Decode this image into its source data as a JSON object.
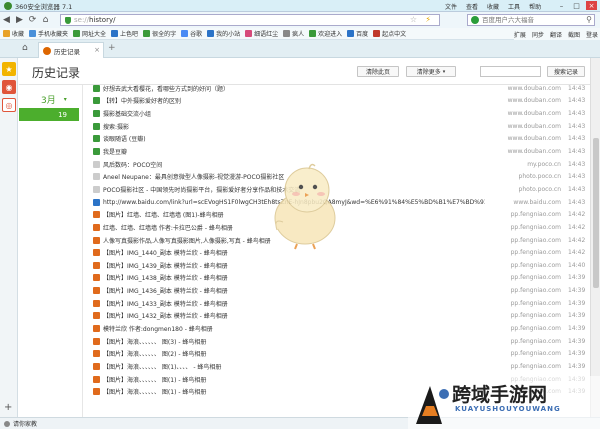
{
  "window": {
    "title": "360安全浏览器 7.1",
    "menus": [
      "文件",
      "查看",
      "收藏",
      "工具",
      "帮助"
    ]
  },
  "address": {
    "scheme": "se://",
    "path": "history/",
    "search_placeholder": "百度用户六大福音"
  },
  "bookmarks": {
    "items": [
      {
        "label": "收藏",
        "color": "#e8a22a"
      },
      {
        "label": "手机收藏夹",
        "color": "#4a90d9"
      },
      {
        "label": "网址大全",
        "color": "#3a9a3a"
      },
      {
        "label": "上色吧",
        "color": "#2b73c7"
      },
      {
        "label": "很全的字",
        "color": "#3a9a3a"
      },
      {
        "label": "谷歌",
        "color": "#4a8af4"
      },
      {
        "label": "我的小站",
        "color": "#2b73c7"
      },
      {
        "label": "细语红尘",
        "color": "#d64a7a"
      },
      {
        "label": "疯人",
        "color": "#888888"
      },
      {
        "label": "欢迎进入",
        "color": "#3a9a3a"
      },
      {
        "label": "百度",
        "color": "#2b73c7"
      },
      {
        "label": "起点中文",
        "color": "#c0392b"
      }
    ],
    "right": [
      "扩展",
      "同步",
      "翻译",
      "截图",
      "登录"
    ]
  },
  "tab": {
    "label": "历史记录"
  },
  "history": {
    "title": "历史记录",
    "clear_page": "清除此页",
    "clear_more": "清除更多",
    "search_button": "搜索记录",
    "month": "3月",
    "day": "19"
  },
  "rows": [
    {
      "title": "好想去武大看樱花，看哪些方式到的好问（题）",
      "host": "www.douban.com",
      "time": "14:43",
      "icon": "#3a9a3a"
    },
    {
      "title": "【转】中外摄影爱好者的区别",
      "host": "www.douban.com",
      "time": "14:43",
      "icon": "#3a9a3a"
    },
    {
      "title": "摄影基础交流小组",
      "host": "www.douban.com",
      "time": "14:43",
      "icon": "#3a9a3a"
    },
    {
      "title": "搜索:摄影",
      "host": "www.douban.com",
      "time": "14:43",
      "icon": "#3a9a3a"
    },
    {
      "title": "谈眼随语 (豆瓣)",
      "host": "www.douban.com",
      "time": "14:43",
      "icon": "#3a9a3a"
    },
    {
      "title": "我是豆瓣",
      "host": "www.douban.com",
      "time": "14:43",
      "icon": "#3a9a3a"
    },
    {
      "title": "风后数码：POCO空间",
      "host": "my.poco.cn",
      "time": "14:43",
      "icon": "#cccccc"
    },
    {
      "title": "Aneel Neupane：最具创意微型人像摄影-视觉漫游-POCO摄影社区",
      "host": "photo.poco.cn",
      "time": "14:43",
      "icon": "#cccccc"
    },
    {
      "title": "POCO摄影社区 - 中国领先时尚摄影平台，摄影爱好者分享作品和技术交流",
      "host": "photo.poco.cn",
      "time": "14:43",
      "icon": "#cccccc"
    },
    {
      "title": "http://www.baidu.com/link?url=scEVogHS1F0lwgCH3tEh8tsZnE-hJn8pbu2QA8myJ&wd=%E6%91%84%E5%BD%B1%E7%BD%91...",
      "host": "www.baidu.com",
      "time": "14:43",
      "icon": "#2b73c7"
    },
    {
      "title": "【图片】红墙、红墙、红墙墙 (图1)-蜂鸟相册",
      "host": "pp.fengniao.com",
      "time": "14:42",
      "icon": "#e06a1c"
    },
    {
      "title": "红墙、红墙、红墙墙 作者:卡拉巴公爵 - 蜂鸟相册",
      "host": "pp.fengniao.com",
      "time": "14:42",
      "icon": "#e06a1c"
    },
    {
      "title": "人像写真摄影作品,人像写真摄影图片,人像摄影,写真 - 蜂鸟相册",
      "host": "pp.fengniao.com",
      "time": "14:42",
      "icon": "#e06a1c"
    },
    {
      "title": "【图片】IMG_1440_副本 模特兰欣 - 蜂鸟相册",
      "host": "pp.fengniao.com",
      "time": "14:42",
      "icon": "#e06a1c"
    },
    {
      "title": "【图片】IMG_1439_副本 模特兰欣 - 蜂鸟相册",
      "host": "pp.fengniao.com",
      "time": "14:40",
      "icon": "#e06a1c"
    },
    {
      "title": "【图片】IMG_1438_副本 模特兰欣 - 蜂鸟相册",
      "host": "pp.fengniao.com",
      "time": "14:39",
      "icon": "#e06a1c"
    },
    {
      "title": "【图片】IMG_1436_副本 模特兰欣 - 蜂鸟相册",
      "host": "pp.fengniao.com",
      "time": "14:39",
      "icon": "#e06a1c"
    },
    {
      "title": "【图片】IMG_1433_副本 模特兰欣 - 蜂鸟相册",
      "host": "pp.fengniao.com",
      "time": "14:39",
      "icon": "#e06a1c"
    },
    {
      "title": "【图片】IMG_1432_副本 模特兰欣 - 蜂鸟相册",
      "host": "pp.fengniao.com",
      "time": "14:39",
      "icon": "#e06a1c"
    },
    {
      "title": "模特兰欣 作者:dongmen180 - 蜂鸟相册",
      "host": "pp.fengniao.com",
      "time": "14:39",
      "icon": "#e06a1c"
    },
    {
      "title": "【图片】海浪、、、、、、 图(3) - 蜂鸟相册",
      "host": "pp.fengniao.com",
      "time": "14:39",
      "icon": "#e06a1c"
    },
    {
      "title": "【图片】海浪、、、、、、 图(2) - 蜂鸟相册",
      "host": "pp.fengniao.com",
      "time": "14:39",
      "icon": "#e06a1c"
    },
    {
      "title": "【图片】海浪、、、、、、 图(1)、、、、 - 蜂鸟相册",
      "host": "pp.fengniao.com",
      "time": "14:39",
      "icon": "#e06a1c"
    },
    {
      "title": "【图片】海浪、、、、、、 图(1) - 蜂鸟相册",
      "host": "pp.fengniao.com",
      "time": "14:39",
      "icon": "#e06a1c"
    },
    {
      "title": "【图片】海浪、、、、、、 图(1) - 蜂鸟相册",
      "host": "pp.fengniao.com",
      "time": "14:39",
      "icon": "#e06a1c"
    }
  ],
  "status": {
    "text": "请你家教"
  },
  "watermark": {
    "text": "跨域手游网",
    "sub": "KUAYUSHOUYOUWANG"
  }
}
